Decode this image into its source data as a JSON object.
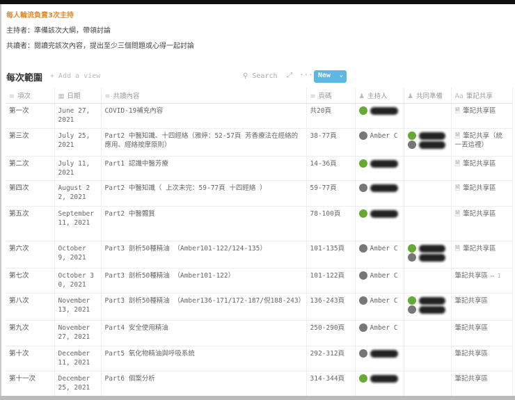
{
  "notes": {
    "title": "每人輪流負責3次主持",
    "host": "主持者：準備該次大綱，帶領討論",
    "reader": "共讀者：閱讀完該次內容，提出至少三個問題或心得一起討論"
  },
  "toolbar": {
    "db_title": "每次範圍",
    "add_view": "+ Add a view",
    "search": "Search",
    "new_label": "New"
  },
  "columns": [
    "項次",
    "日期",
    "共讀內容",
    "頁碼",
    "主持人",
    "共同準備",
    "筆記共享"
  ],
  "rows": [
    {
      "session": "第一次",
      "date": "June 27, 2021",
      "content": "COVID-19補充內容",
      "pages": "共20頁",
      "host": "",
      "notes": "筆記共享區",
      "doc": true
    },
    {
      "session": "第三次",
      "date": "July 25, 2021",
      "content": "Part2 中醫知識、十四經絡（雅婷：52-57頁 芳香療法在經絡的應用、經絡按摩原則）",
      "pages": "38-77頁",
      "host": "Amber C",
      "notes": "筆記共享（統一丟這裡）",
      "doc": true,
      "prep": 2
    },
    {
      "session": "第二次",
      "date": "July 11, 2021",
      "content": "Part1 認識中醫芳療",
      "pages": "14-36頁",
      "host": "",
      "notes": "筆記共享區",
      "doc": true
    },
    {
      "session": "第四次",
      "date": "August 22, 2021",
      "content": "Part2 中醫知識（ 上次未完：59-77頁 十四經絡 ）",
      "pages": "59-77頁",
      "host": "",
      "notes": "筆記共享區",
      "doc": true
    },
    {
      "session": "第五次",
      "date": "September 11, 2021",
      "content": "Part2 中醫體質",
      "pages": "78-100頁",
      "host": "",
      "notes": "筆記共享區",
      "doc": true
    },
    {
      "session": "第六次",
      "date": "October 9, 2021",
      "content": "Part3 剖析50種精油 （Amber101-122/124-135）",
      "pages": "101-135頁",
      "host": "Amber C",
      "notes": "筆記共享區",
      "doc": true,
      "prep": 2
    },
    {
      "session": "第七次",
      "date": "October 30, 2021",
      "content": "Part3 剖析50種精油 （Amber101-122）",
      "pages": "101-122頁",
      "host": "Amber C",
      "notes": "筆記共享區",
      "comments": "1"
    },
    {
      "session": "第八次",
      "date": "November 13, 2021",
      "content": "Part3 剖析50種精油 （Amber136-171/172-187/倪188-243）",
      "pages": "136-243頁",
      "host": "Amber C",
      "notes": "筆記共享區",
      "prep": 2
    },
    {
      "session": "第九次",
      "date": "November 27, 2021",
      "content": "Part4 安全使用精油",
      "pages": "250-290頁",
      "host": "Amber C",
      "notes": "筆記共享區"
    },
    {
      "session": "第十次",
      "date": "December 11, 2021",
      "content": "Part5 氧化物精油與呼吸系統",
      "pages": "292-312頁",
      "host": "",
      "notes": "筆記共享區"
    },
    {
      "session": "第十一次",
      "date": "December 25, 2021",
      "content": "Part6 個案分析",
      "pages": "314-344頁",
      "host": "",
      "notes": "筆記共享區"
    }
  ],
  "colors": {
    "accent": "#5ab8e3",
    "title_orange": "#e08a2c"
  }
}
